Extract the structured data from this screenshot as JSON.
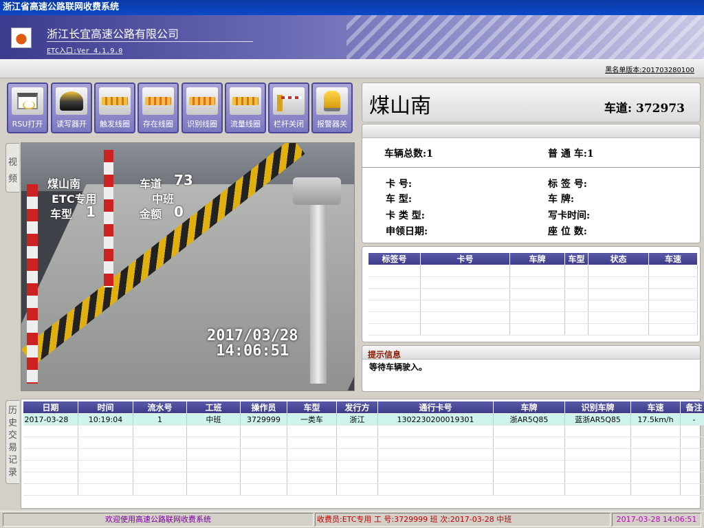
{
  "window": {
    "title": "浙江省高速公路联网收费系统"
  },
  "header": {
    "logo_glyph": "",
    "company": "浙江长宜高速公路有限公司",
    "version": "ETC入口:Ver 4.1.9.0",
    "blacklist": "黑名单版本:201703280100"
  },
  "toolbar": {
    "buttons": [
      {
        "label": "RSU打开",
        "icon": "rsu-icon"
      },
      {
        "label": "读写器开",
        "icon": "card-reader-icon"
      },
      {
        "label": "触发线圈",
        "icon": "loop-icon"
      },
      {
        "label": "存在线圈",
        "icon": "loop-icon"
      },
      {
        "label": "识别线圈",
        "icon": "loop-icon"
      },
      {
        "label": "流量线圈",
        "icon": "loop-icon"
      },
      {
        "label": "栏杆关闭",
        "icon": "barrier-gate-icon"
      },
      {
        "label": "报警器关",
        "icon": "alarm-icon"
      }
    ]
  },
  "tabs": {
    "video": "视频",
    "history": "历史交易记录"
  },
  "video": {
    "osd_station": "煤山南",
    "osd_etc": "ETC专用",
    "osd_vtype_label": "车型",
    "osd_vtype_value": "1",
    "osd_lane_label": "车道",
    "osd_lane_value": "73",
    "osd_shift": "中班",
    "osd_amount_label": "金额",
    "osd_amount_value": "0",
    "timestamp_date": "2017/03/28",
    "timestamp_time": "14:06:51"
  },
  "station": {
    "name": "煤山南",
    "lane": "车道: 372973"
  },
  "summary": {
    "total": "车辆总数:1",
    "normal": "普 通 车:1"
  },
  "card_info": {
    "card_no": "卡    号:",
    "vehicle_type": "车    型:",
    "card_type": "卡 类 型:",
    "apply_date": "申领日期:",
    "tag_no": "标 签 号:",
    "plate": "车    牌:",
    "write_time": "写卡时间:",
    "seats": "座 位 数:"
  },
  "tag_table": {
    "columns": [
      "标签号",
      "卡号",
      "车牌",
      "车型",
      "状态",
      "车速"
    ]
  },
  "hint": {
    "title": "提示信息",
    "text": "等待车辆驶入。"
  },
  "history": {
    "columns": [
      "日期",
      "时间",
      "流水号",
      "工班",
      "操作员",
      "车型",
      "发行方",
      "通行卡号",
      "车牌",
      "识别车牌",
      "车速",
      "备注"
    ],
    "rows": [
      [
        "2017-03-28",
        "10:19:04",
        "1",
        "中班",
        "3729999",
        "一类车",
        "浙江",
        "1302230200019301",
        "浙AR5Q85",
        "蓝浙AR5Q85",
        "17.5km/h",
        "-"
      ]
    ]
  },
  "statusbar": {
    "welcome": "欢迎使用高速公路联网收费系统",
    "shift_info": "收费员:ETC专用    工  号:3729999    班  次:2017-03-28  中班",
    "clock": "2017-03-28  14:06:51"
  }
}
